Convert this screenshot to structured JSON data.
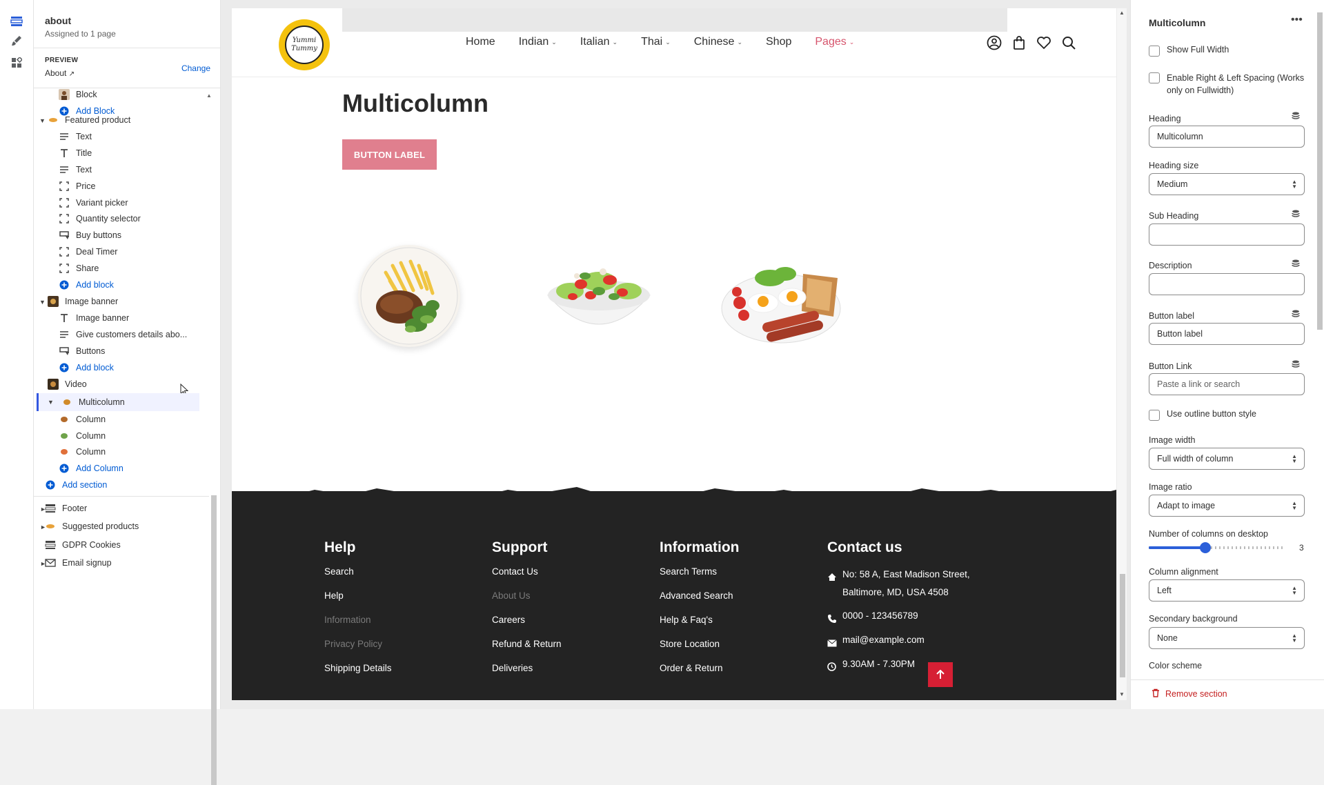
{
  "sidebar": {
    "title": "about",
    "subtitle": "Assigned to 1 page",
    "preview_label": "PREVIEW",
    "preview_value": "About",
    "change_label": "Change",
    "items": [
      {
        "label": "Block",
        "icon": "person-thumbnail"
      },
      {
        "label": "Add Block",
        "icon": "plus-circle-icon"
      },
      {
        "label": "Featured product",
        "icon": "food-thumbnail"
      },
      {
        "label": "Text",
        "icon": "text-lines-icon"
      },
      {
        "label": "Title",
        "icon": "title-t-icon"
      },
      {
        "label": "Text",
        "icon": "text-lines-icon"
      },
      {
        "label": "Price",
        "icon": "frame-icon"
      },
      {
        "label": "Variant picker",
        "icon": "frame-icon"
      },
      {
        "label": "Quantity selector",
        "icon": "frame-icon"
      },
      {
        "label": "Buy buttons",
        "icon": "buttons-icon"
      },
      {
        "label": "Deal Timer",
        "icon": "frame-icon"
      },
      {
        "label": "Share",
        "icon": "frame-icon"
      },
      {
        "label": "Add block",
        "icon": "plus-circle-icon"
      },
      {
        "label": "Image banner",
        "icon": "image-thumbnail"
      },
      {
        "label": "Image banner",
        "icon": "title-t-icon"
      },
      {
        "label": "Give customers details abo...",
        "icon": "text-lines-icon"
      },
      {
        "label": "Buttons",
        "icon": "buttons-icon"
      },
      {
        "label": "Add block",
        "icon": "plus-circle-icon"
      },
      {
        "label": "Video",
        "icon": "video-thumbnail"
      },
      {
        "label": "Multicolumn",
        "icon": "food-thumbnail"
      },
      {
        "label": "Column",
        "icon": "food-thumbnail"
      },
      {
        "label": "Column",
        "icon": "food-thumbnail"
      },
      {
        "label": "Column",
        "icon": "food-thumbnail"
      },
      {
        "label": "Add Column",
        "icon": "plus-circle-icon"
      },
      {
        "label": "Add section",
        "icon": "plus-circle-icon"
      },
      {
        "label": "Footer",
        "icon": "footer-layout-icon"
      },
      {
        "label": "Suggested products",
        "icon": "food-thumbnail"
      },
      {
        "label": "GDPR Cookies",
        "icon": "footer-layout-icon"
      },
      {
        "label": "Email signup",
        "icon": "mail-icon"
      }
    ]
  },
  "store": {
    "logo_line1": "Yummi",
    "logo_line2": "Tummy",
    "nav": [
      {
        "label": "Home",
        "dropdown": false
      },
      {
        "label": "Indian",
        "dropdown": true
      },
      {
        "label": "Italian",
        "dropdown": true
      },
      {
        "label": "Thai",
        "dropdown": true
      },
      {
        "label": "Chinese",
        "dropdown": true
      },
      {
        "label": "Shop",
        "dropdown": false
      },
      {
        "label": "Pages",
        "dropdown": true
      }
    ],
    "nav_active_color": "#d6546c",
    "section_title": "Multicolumn",
    "button_label": "BUTTON LABEL",
    "button_color": "#e07f8e"
  },
  "footer": {
    "help": {
      "heading": "Help",
      "links": [
        "Search",
        "Help",
        "Information",
        "Privacy Policy",
        "Shipping Details"
      ]
    },
    "support": {
      "heading": "Support",
      "links": [
        "Contact Us",
        "About Us",
        "Careers",
        "Refund & Return",
        "Deliveries"
      ]
    },
    "information": {
      "heading": "Information",
      "links": [
        "Search Terms",
        "Advanced Search",
        "Help & Faq's",
        "Store Location",
        "Order & Return"
      ]
    },
    "contact": {
      "heading": "Contact us",
      "address_line1": "No: 58 A, East Madison Street,",
      "address_line2": "Baltimore, MD, USA 4508",
      "phone": "0000 - 123456789",
      "email": "mail@example.com",
      "hours": "9.30AM - 7.30PM"
    }
  },
  "settings": {
    "title": "Multicolumn",
    "show_full_width": "Show Full Width",
    "enable_spacing": "Enable Right & Left Spacing (Works only on Fullwidth)",
    "heading_label": "Heading",
    "heading_value": "Multicolumn",
    "heading_size_label": "Heading size",
    "heading_size_value": "Medium",
    "sub_heading_label": "Sub Heading",
    "sub_heading_value": "",
    "description_label": "Description",
    "description_value": "",
    "button_label_label": "Button label",
    "button_label_value": "Button label",
    "button_link_label": "Button Link",
    "button_link_placeholder": "Paste a link or search",
    "outline_label": "Use outline button style",
    "image_width_label": "Image width",
    "image_width_value": "Full width of column",
    "image_ratio_label": "Image ratio",
    "image_ratio_value": "Adapt to image",
    "columns_label": "Number of columns on desktop",
    "columns_value": "3",
    "alignment_label": "Column alignment",
    "alignment_value": "Left",
    "secondary_bg_label": "Secondary background",
    "secondary_bg_value": "None",
    "color_scheme_label": "Color scheme",
    "remove_label": "Remove section",
    "accent": "#2b5fd9"
  }
}
